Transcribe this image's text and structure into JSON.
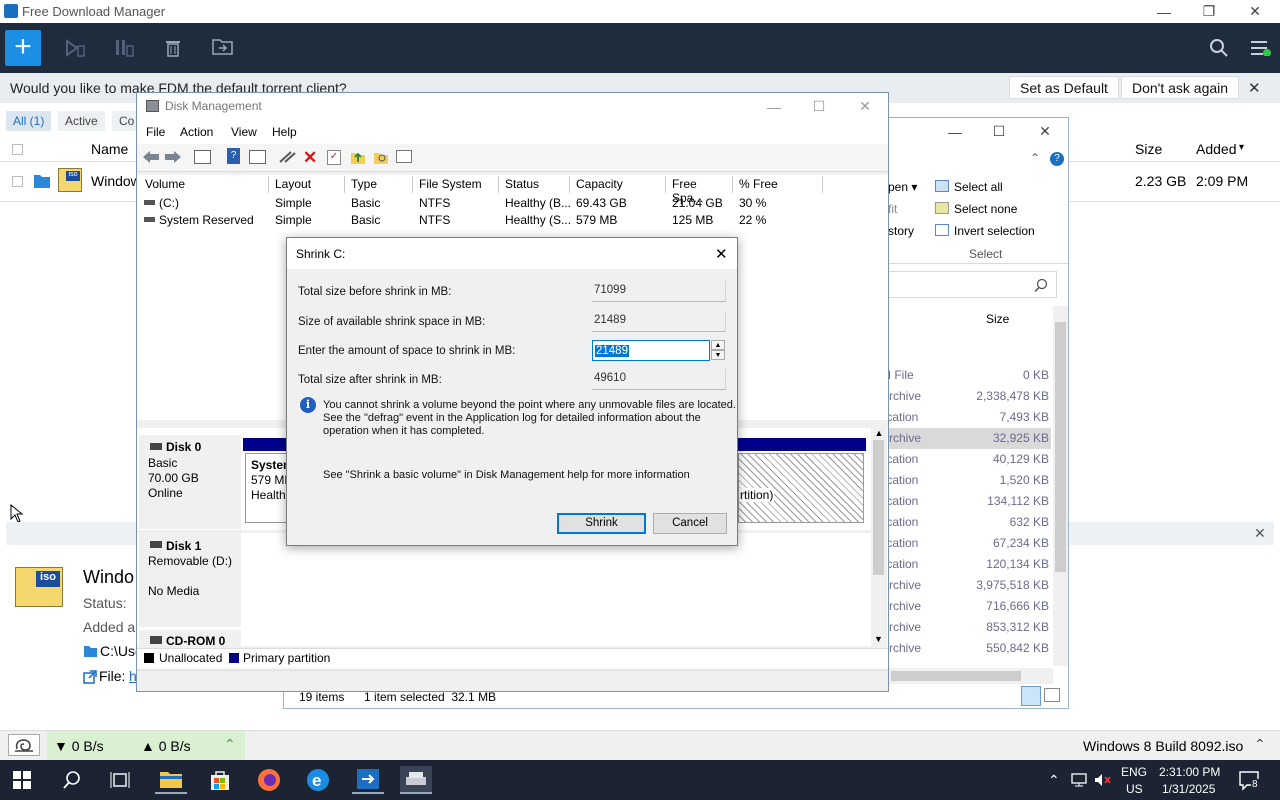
{
  "fdm": {
    "title": "Free Download Manager",
    "banner_question": "Would you like to make FDM the default torrent client?",
    "set_default": "Set as Default",
    "dont_ask": "Don't ask again",
    "tabs": [
      "All (1)",
      "Active",
      "Co"
    ],
    "col_name": "Name",
    "col_size": "Size",
    "col_added": "Added",
    "row_name": "Window",
    "row_size": "2.23 GB",
    "row_added": "2:09 PM",
    "details_title": "Windo",
    "details_status": "Status:",
    "details_added": "Added a",
    "details_path": "C:\\Use",
    "details_file": "File:",
    "details_file_link": "h",
    "download_speed": "▼ 0 B/s",
    "upload_speed": "▲ 0 B/s",
    "status_file": "Windows 8 Build 8092.iso"
  },
  "explorer": {
    "ribbon": [
      "Select all",
      "Select none",
      "Invert selection"
    ],
    "ribbon_group": "Select",
    "ribbon_left": [
      "pen ▾",
      "fit",
      "story"
    ],
    "size_header": "Size",
    "rows": [
      {
        "type": "M File",
        "size": "0 KB"
      },
      {
        "type": "Archive",
        "size": "2,338,478 KB"
      },
      {
        "type": "lication",
        "size": "7,493 KB"
      },
      {
        "type": "Archive",
        "size": "32,925 KB"
      },
      {
        "type": "lication",
        "size": "40,129 KB"
      },
      {
        "type": "lication",
        "size": "1,520 KB"
      },
      {
        "type": "lication",
        "size": "134,112 KB"
      },
      {
        "type": "lication",
        "size": "632 KB"
      },
      {
        "type": "lication",
        "size": "67,234 KB"
      },
      {
        "type": "lication",
        "size": "120,134 KB"
      },
      {
        "type": "Archive",
        "size": "3,975,518 KB"
      },
      {
        "type": "Archive",
        "size": "716,666 KB"
      },
      {
        "type": "Archive",
        "size": "853,312 KB"
      },
      {
        "type": "Archive",
        "size": "550,842 KB"
      }
    ],
    "items_count": "19 items",
    "selected": "1 item selected  32.1 MB"
  },
  "dm": {
    "title": "Disk Management",
    "menu": [
      "File",
      "Action",
      "View",
      "Help"
    ],
    "columns": [
      "Volume",
      "Layout",
      "Type",
      "File System",
      "Status",
      "Capacity",
      "Free Spa...",
      "% Free"
    ],
    "volumes": [
      [
        "(C:)",
        "Simple",
        "Basic",
        "NTFS",
        "Healthy (B...",
        "69.43 GB",
        "21.04 GB",
        "30 %"
      ],
      [
        "System Reserved",
        "Simple",
        "Basic",
        "NTFS",
        "Healthy (S...",
        "579 MB",
        "125 MB",
        "22 %"
      ]
    ],
    "disk0": {
      "name": "Disk 0",
      "type": "Basic",
      "size": "70.00 GB",
      "state": "Online"
    },
    "disk0_part1": {
      "name": "System",
      "size": "579 MB",
      "status": "Healthy"
    },
    "disk0_part2_tail": "rtition)",
    "disk1": {
      "name": "Disk 1",
      "type": "Removable (D:)",
      "state": "No Media"
    },
    "cdrom": "CD-ROM 0",
    "legend": [
      "Unallocated",
      "Primary partition"
    ]
  },
  "shrink": {
    "title": "Shrink C:",
    "total_before_label": "Total size before shrink in MB:",
    "total_before": "71099",
    "available_label": "Size of available shrink space in MB:",
    "available": "21489",
    "enter_label": "Enter the amount of space to shrink in MB:",
    "enter_value": "21489",
    "after_label": "Total size after shrink in MB:",
    "after": "49610",
    "info_line1": "You cannot shrink a volume beyond the point where any unmovable files are located.",
    "info_line2": "See the \"defrag\" event in the Application log for detailed information about the",
    "info_line3": "operation when it has completed.",
    "help_text": "See \"Shrink a basic volume\" in Disk Management help for more information",
    "shrink_btn": "Shrink",
    "cancel_btn": "Cancel"
  },
  "taskbar": {
    "lang1": "ENG",
    "lang2": "US",
    "time": "2:31:00 PM",
    "date": "1/31/2025",
    "notif_count": "8"
  }
}
